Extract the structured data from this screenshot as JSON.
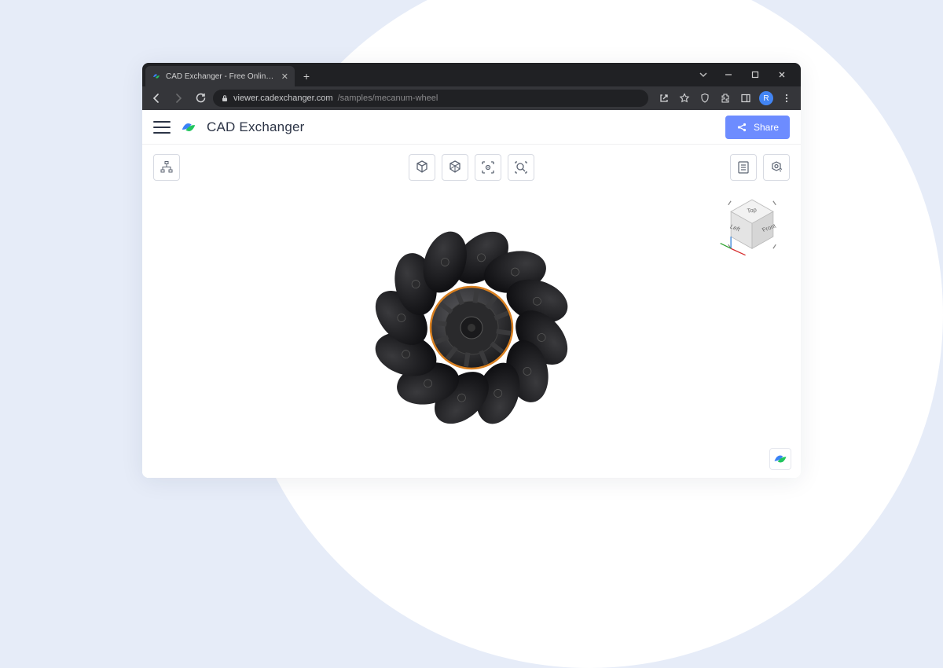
{
  "browser": {
    "tab_title": "CAD Exchanger - Free Online Vie",
    "url_host": "viewer.cadexchanger.com",
    "url_path": "/samples/mecanum-wheel",
    "avatar_initial": "R"
  },
  "app": {
    "brand": "CAD Exchanger",
    "share_label": "Share"
  },
  "viewcube": {
    "top": "Top",
    "left": "Left",
    "front": "Front"
  }
}
